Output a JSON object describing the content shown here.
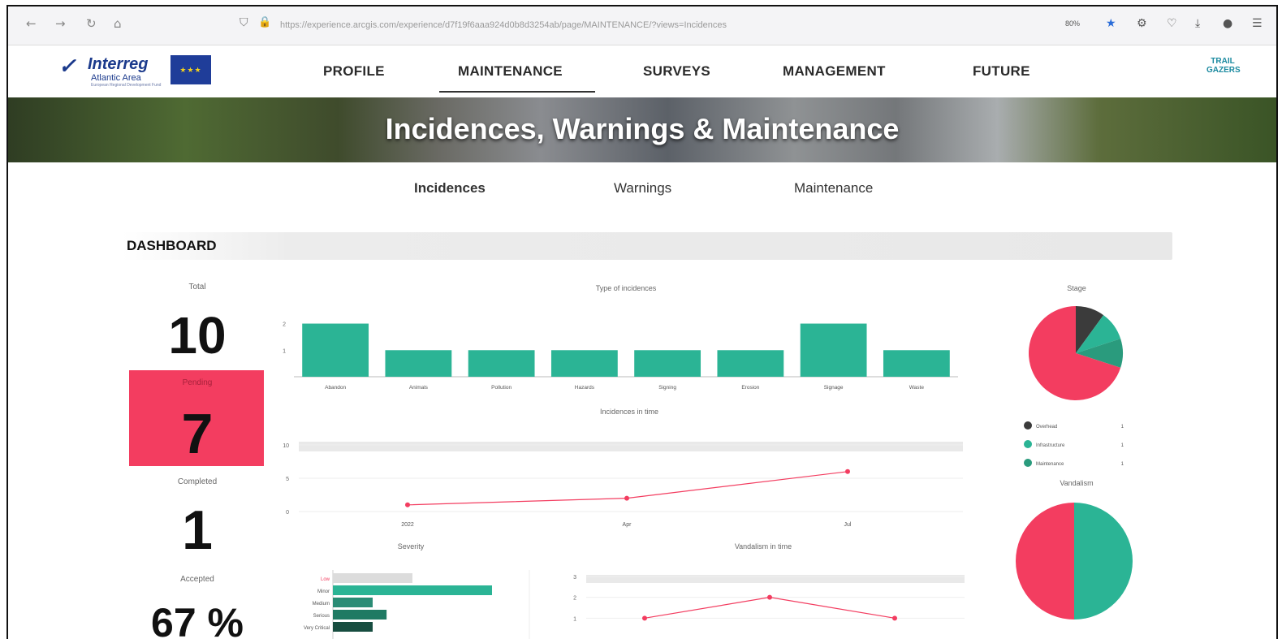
{
  "browser": {
    "url": "https://experience.arcgis.com/experience/d7f19f6aaa924d0b8d3254ab/page/MAINTENANCE/?views=Incidences",
    "zoom": "80%"
  },
  "nav": {
    "brand": "Interreg",
    "brand_sub": "Atlantic Area",
    "brand_tiny": "European Regional Development Fund",
    "items": [
      "PROFILE",
      "MAINTENANCE",
      "SURVEYS",
      "MANAGEMENT",
      "FUTURE"
    ],
    "active": "MAINTENANCE",
    "partner_logo": "TRAIL GAZERS"
  },
  "banner": {
    "title": "Incidences, Warnings & Maintenance"
  },
  "subtabs": {
    "items": [
      "Incidences",
      "Warnings",
      "Maintenance"
    ],
    "active": "Incidences"
  },
  "dashboard": {
    "title": "DASHBOARD",
    "total_label": "Total",
    "total_value": "10",
    "pending_label": "Pending",
    "pending_value": "7",
    "completed_label": "Completed",
    "completed_value": "1",
    "accepted_label": "Accepted",
    "accepted_value": "67 %"
  },
  "colors": {
    "teal": "#2bb495",
    "pink": "#f33d60",
    "dark": "#3b3b3b",
    "darkteal": "#1f7a63"
  },
  "chart_data": [
    {
      "type": "bar",
      "title": "Type of incidences",
      "categories": [
        "Abandon",
        "Animals",
        "Pollution",
        "Hazards",
        "Signing",
        "Erosion",
        "Signage",
        "Waste"
      ],
      "values": [
        2,
        1,
        1,
        1,
        1,
        1,
        2,
        1
      ],
      "yticks": [
        1,
        2
      ],
      "ylim": [
        0,
        2.2
      ]
    },
    {
      "type": "line",
      "title": "Incidences in time",
      "x": [
        "2022",
        "Apr",
        "Jul"
      ],
      "values": [
        1,
        2,
        6
      ],
      "yticks": [
        0,
        5,
        10
      ],
      "ylim": [
        0,
        10
      ]
    },
    {
      "type": "pie",
      "title": "Stage",
      "labels": [
        "Overhead",
        "Infrastructure",
        "Maintenance"
      ],
      "values": [
        1,
        1,
        1
      ],
      "slices": [
        {
          "label": "Overhead",
          "value": 1,
          "color": "#3b3b3b"
        },
        {
          "label": "Infrastructure",
          "value": 1,
          "color": "#2bb495"
        },
        {
          "label": "Maintenance",
          "value": 1,
          "color": "#2a9b7d"
        },
        {
          "label": "",
          "value": 7,
          "color": "#f33d60"
        }
      ]
    },
    {
      "type": "pie",
      "title": "Vandalism",
      "slices": [
        {
          "label": "",
          "value": 1,
          "color": "#2bb495"
        },
        {
          "label": "",
          "value": 1,
          "color": "#f33d60"
        }
      ]
    },
    {
      "type": "bar",
      "title": "Severity",
      "orientation": "horizontal",
      "categories": [
        "Low",
        "Minor",
        "Medium",
        "Serious",
        "Very Critical"
      ],
      "values": [
        4,
        8,
        2,
        2.7,
        2
      ],
      "colors": [
        "#dcdcdc",
        "#2bb495",
        "#2a8c75",
        "#1f7a63",
        "#174d40"
      ]
    },
    {
      "type": "line",
      "title": "Vandalism in time",
      "x": [
        "",
        "",
        ""
      ],
      "values": [
        1,
        2,
        1
      ],
      "yticks": [
        1,
        2,
        3
      ],
      "ylim": [
        0,
        3
      ]
    }
  ]
}
